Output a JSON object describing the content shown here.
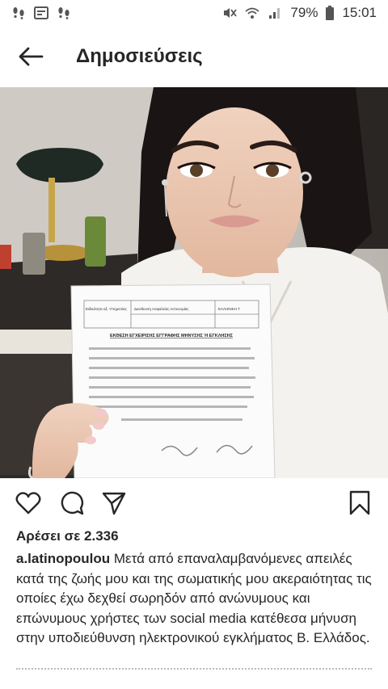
{
  "status_bar": {
    "left_icons": [
      "footprints-icon",
      "gallery-icon",
      "footprints-icon"
    ],
    "right_icons": [
      "mute-icon",
      "wifi-icon",
      "signal-icon"
    ],
    "battery": "79%",
    "time": "15:01"
  },
  "header": {
    "back_icon": "arrow-left-icon",
    "title": "Δημοσιεύσεις"
  },
  "post": {
    "actions": [
      "heart-icon",
      "comment-icon",
      "share-icon",
      "bookmark-icon"
    ],
    "likes_text": "Αρέσει σε 2.336",
    "username": "a.latinopoulou",
    "caption": "Μετά από επαναλαμβανόμενες απειλές κατά της ζωής μου και της σωματικής μου ακεραιότητας τις οποίες έχω δεχθεί σωρηδόν από ανώνυμους και επώνυμους χρήστες των social media κατέθεσα μήνυση στην υποδιεύθυνση ηλεκτρονικού εγκλήματος Β. Ελλάδος.",
    "document": {
      "header_cell_1": "Ειδικότητα αξ. Υπηρεσίας",
      "header_cell_2": "Διευθυνση Ασφαλείας Αστυνομίας",
      "header_cell_3": "ΕΛΛΗΝΙΚΗ Τ",
      "title": "ΕΚΘΕΣΗ ΕΓΧΕΙΡΙΣΗΣ ΕΓΓΡΑΦΗΣ ΜΗΝΥΣΗΣ Ή ΕΓΚΛΗΣΗΣ"
    }
  }
}
